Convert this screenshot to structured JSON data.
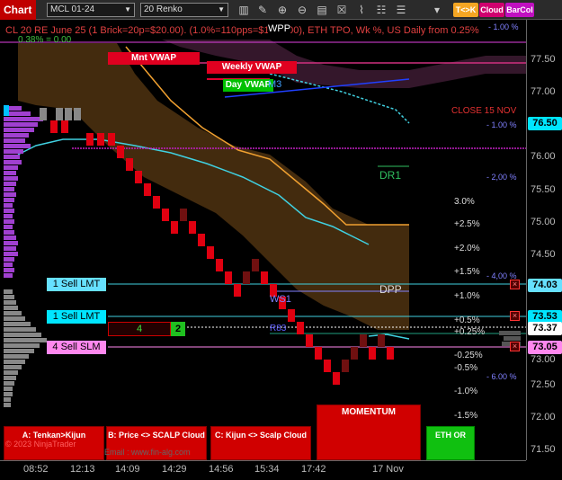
{
  "toolbar": {
    "chart_tab": "Chart",
    "instrument": "MCL 01-24",
    "bar_type": "20 Renko",
    "icons": [
      "bar-style-icon",
      "draw-pencil-icon",
      "zoom-in-icon",
      "zoom-out-icon",
      "properties-icon",
      "strategy-icon",
      "indicator-icon",
      "template-icon",
      "template-list-icon"
    ],
    "tk_button": "T<>K",
    "cloud_button": "Cloud",
    "barcol_button": "BarCol",
    "colors": {
      "tk": "#f5a623",
      "cloud": "#d0006f",
      "barcol": "#c010c0"
    }
  },
  "chart": {
    "header": "CL 20 RE June 25 (1 Brick=20p=$20.00). (1.0%=110pps=$1100.00), ETH TPO, Wk %, US Daily from 0.25%",
    "left_pct": "0.38% = 0.00",
    "wpp_label": "WPP",
    "mnt_vwap": "Mnt VWAP",
    "weekly_vwap": "Weekly VWAP",
    "day_vwap": "Day VWAP",
    "m_label": "M3",
    "close_label": "CLOSE 15 NOV",
    "dr1_label": "DR1",
    "dpp_label": "DPP",
    "ws1_label": "WS1",
    "rs_label": "R83",
    "momentum_label": "MOMENTUM",
    "watermark": "© 2023 NinjaTrader",
    "url_watermark": "Email : www.fin-alg.com",
    "percent_levels": [
      "3.0%",
      "+2.5%",
      "+2.0%",
      "+1.5%",
      "+1.0%",
      "+0.5%",
      "+0.25%",
      "-0.25%",
      "-0.5%",
      "-1.0%",
      "-1.5%"
    ],
    "weekly_pct": [
      "- 1.00 %",
      "- 1.00 %",
      "- 2,00 %",
      "- 4,00 %",
      "- 6.00 %"
    ],
    "orders": [
      {
        "label": "1 Sell LMT",
        "price": "74.03"
      },
      {
        "label": "1 Sell LMT",
        "price": "73.53"
      },
      {
        "label": "4 Sell SLM",
        "price": "73.05"
      }
    ],
    "position_qty": "4",
    "position_green": "2",
    "bottom_buttons": [
      "A: Tenkan>Kijun",
      "B: Price <> SCALP Cloud",
      "C: Kijun <> Scalp Cloud",
      "ETH OR"
    ]
  },
  "price_axis": {
    "ticks": [
      "77.50",
      "77.00",
      "76.00",
      "75.50",
      "75.00",
      "74.50",
      "73.00",
      "72.50",
      "72.00",
      "71.50"
    ],
    "tags": [
      {
        "value": "76.50",
        "color": "#00e5ff"
      },
      {
        "value": "74.03",
        "color": "#66e0ff"
      },
      {
        "value": "73.53",
        "color": "#00e5ff"
      },
      {
        "value": "73.37",
        "color": "#ffffff"
      },
      {
        "value": "73.05",
        "color": "#ff88ee"
      }
    ]
  },
  "time_axis": {
    "ticks": [
      "08:52",
      "12:13",
      "14:09",
      "14:29",
      "14:56",
      "15:34",
      "17:42",
      "17 Nov"
    ]
  }
}
